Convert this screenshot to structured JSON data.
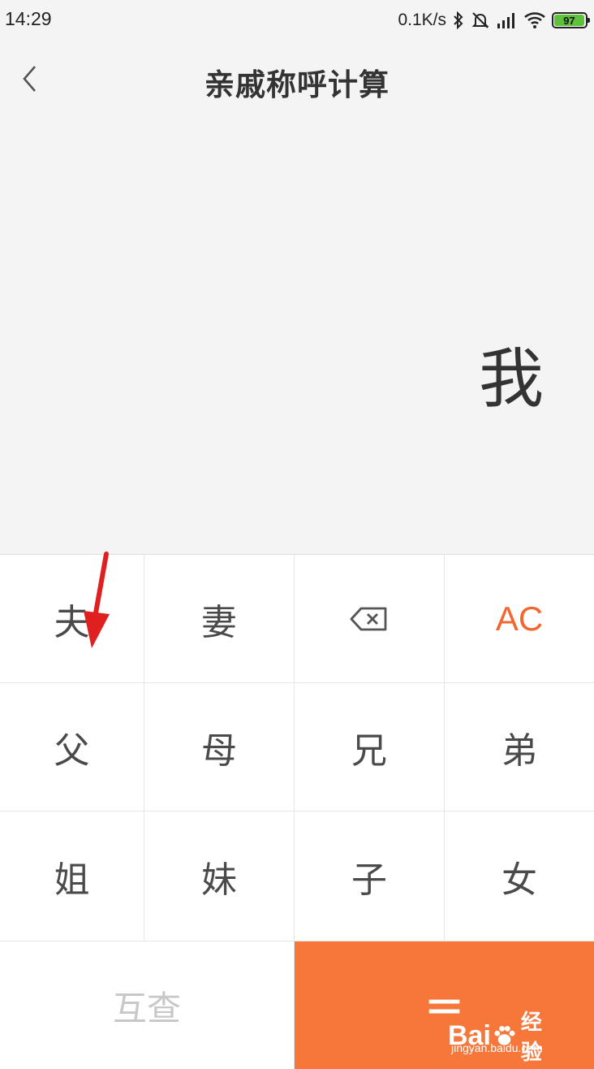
{
  "status_bar": {
    "time": "14:29",
    "net_speed": "0.1K/s",
    "battery": "97",
    "icons": [
      "bluetooth-icon",
      "mute-icon",
      "signal-icon",
      "wifi-icon",
      "battery-icon"
    ]
  },
  "header": {
    "title": "亲戚称呼计算",
    "back_icon": "chevron-left-icon"
  },
  "display": {
    "value": "我"
  },
  "keypad": {
    "row1": [
      "夫",
      "妻",
      "",
      "AC"
    ],
    "row2": [
      "父",
      "母",
      "兄",
      "弟"
    ],
    "row3": [
      "姐",
      "妹",
      "子",
      "女"
    ],
    "reverse_label": "互查",
    "equals_label": "=",
    "backspace_icon": "backspace-icon"
  },
  "colors": {
    "accent": "#f7773b",
    "ac_text": "#f2672f",
    "annotation_arrow": "#e02020"
  },
  "watermark": {
    "logo_left": "Bai",
    "logo_right": "经验",
    "url": "jingyan.baidu.com"
  }
}
